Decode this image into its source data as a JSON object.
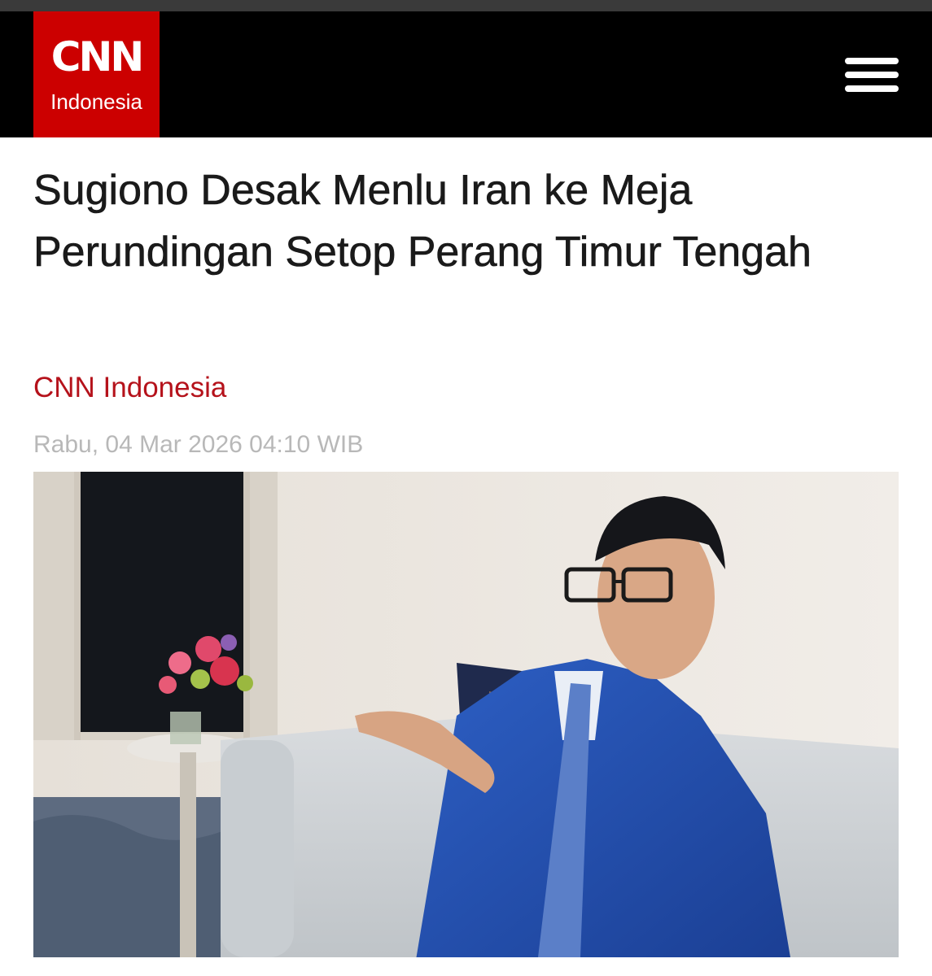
{
  "header": {
    "logo_text": "CNN",
    "logo_subtext": "Indonesia",
    "menu_icon": "hamburger-menu-icon",
    "brand_color": "#cc0000"
  },
  "article": {
    "title": "Sugiono Desak Menlu Iran ke Meja Perundingan Setop Perang Timur Tengah",
    "source": "CNN Indonesia",
    "timestamp": "Rabu, 04 Mar 2026 04:10 WIB",
    "source_color": "#b5121b"
  }
}
